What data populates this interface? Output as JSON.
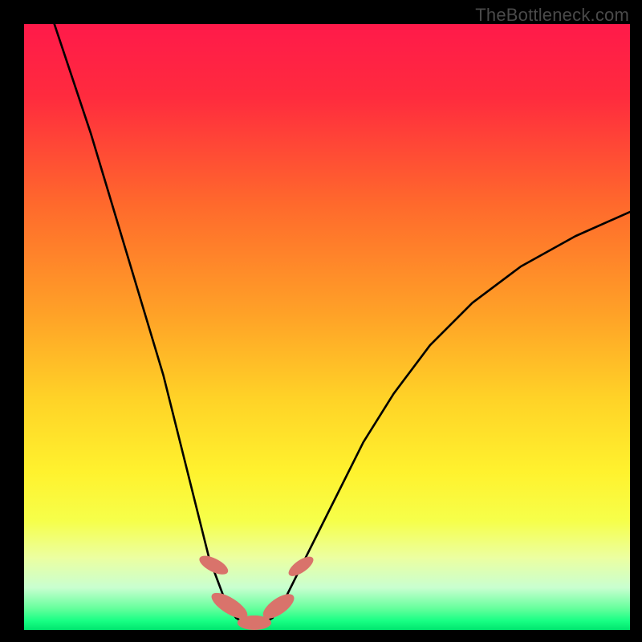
{
  "watermark": "TheBottleneck.com",
  "chart_data": {
    "type": "line",
    "title": "",
    "xlabel": "",
    "ylabel": "",
    "xlim": [
      0,
      100
    ],
    "ylim": [
      0,
      100
    ],
    "grid": false,
    "legend": false,
    "background_gradient_stops": [
      {
        "offset": 0.0,
        "color": "#ff1a4a"
      },
      {
        "offset": 0.12,
        "color": "#ff2b3e"
      },
      {
        "offset": 0.3,
        "color": "#ff6a2c"
      },
      {
        "offset": 0.48,
        "color": "#ffa227"
      },
      {
        "offset": 0.62,
        "color": "#ffd327"
      },
      {
        "offset": 0.74,
        "color": "#fff22e"
      },
      {
        "offset": 0.82,
        "color": "#f6ff4a"
      },
      {
        "offset": 0.88,
        "color": "#ecffa0"
      },
      {
        "offset": 0.93,
        "color": "#c9ffd0"
      },
      {
        "offset": 0.965,
        "color": "#64ff9c"
      },
      {
        "offset": 0.985,
        "color": "#18ff84"
      },
      {
        "offset": 1.0,
        "color": "#00e56e"
      }
    ],
    "series": [
      {
        "name": "bottleneck-left",
        "color": "#000000",
        "x": [
          5,
          8,
          11,
          14,
          17,
          20,
          23,
          25,
          27,
          29,
          30.5,
          32,
          33.5,
          35
        ],
        "y": [
          100,
          91,
          82,
          72,
          62,
          52,
          42,
          34,
          26,
          18,
          12,
          8,
          4,
          2
        ]
      },
      {
        "name": "bottleneck-right",
        "color": "#000000",
        "x": [
          41,
          43,
          45,
          48,
          52,
          56,
          61,
          67,
          74,
          82,
          91,
          100
        ],
        "y": [
          2,
          5,
          9,
          15,
          23,
          31,
          39,
          47,
          54,
          60,
          65,
          69
        ]
      },
      {
        "name": "valley-floor",
        "color": "#000000",
        "x": [
          35,
          36.5,
          38,
          39.5,
          41
        ],
        "y": [
          2,
          1,
          1,
          1,
          2
        ]
      }
    ],
    "markers": [
      {
        "name": "left-upper-blob",
        "cx": 31.3,
        "cy": 10.7,
        "rx": 1.1,
        "ry": 2.6,
        "rot": -63,
        "color": "#d9736b"
      },
      {
        "name": "left-lower-blob",
        "cx": 33.9,
        "cy": 4.0,
        "rx": 1.3,
        "ry": 3.4,
        "rot": -58,
        "color": "#d9736b"
      },
      {
        "name": "floor-blob",
        "cx": 38.0,
        "cy": 1.2,
        "rx": 2.8,
        "ry": 1.2,
        "rot": 0,
        "color": "#d9736b"
      },
      {
        "name": "right-lower-blob",
        "cx": 42.0,
        "cy": 3.9,
        "rx": 1.3,
        "ry": 3.0,
        "rot": 55,
        "color": "#d9736b"
      },
      {
        "name": "right-upper-blob",
        "cx": 45.7,
        "cy": 10.5,
        "rx": 1.0,
        "ry": 2.4,
        "rot": 55,
        "color": "#d9736b"
      }
    ]
  }
}
